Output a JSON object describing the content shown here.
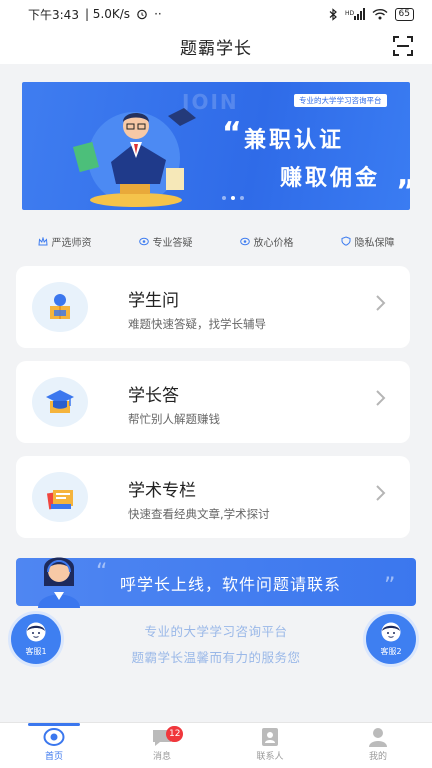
{
  "status_bar": {
    "time": "下午3:43",
    "network_speed": "| 5.0K/s",
    "extra_dots": "··",
    "signal_text": "HD",
    "battery": "65"
  },
  "header": {
    "title": "题霸学长"
  },
  "banner": {
    "watermark": "JOIN",
    "tagline": "专业的大学学习咨询平台",
    "headline_1": "兼职认证",
    "headline_2": "赚取佣金",
    "open_quote": "“",
    "close_quote": "”"
  },
  "features": [
    {
      "label": "严选师资",
      "icon": "crown-icon"
    },
    {
      "label": "专业答疑",
      "icon": "eye-icon"
    },
    {
      "label": "放心价格",
      "icon": "eye-icon"
    },
    {
      "label": "隐私保障",
      "icon": "shield-icon"
    }
  ],
  "cards": [
    {
      "title": "学生问",
      "desc": "难题快速答疑，找学长辅导",
      "icon": "student-book-icon"
    },
    {
      "title": "学长答",
      "desc": "帮忙别人解题赚钱",
      "icon": "graduation-cap-icon"
    },
    {
      "title": "学术专栏",
      "desc": "快速查看经典文章,学术探讨",
      "icon": "books-icon"
    }
  ],
  "contact": {
    "text": "呼学长上线，软件问题请联系",
    "quote_open": "“",
    "quote_close": "”"
  },
  "slogans": [
    "专业的大学学习咨询平台",
    "题霸学长温馨而有力的服务您"
  ],
  "kefu": [
    {
      "label": "客服1"
    },
    {
      "label": "客服2"
    }
  ],
  "tabs": [
    {
      "label": "首页",
      "active": true
    },
    {
      "label": "消息",
      "badge": "12"
    },
    {
      "label": "联系人"
    },
    {
      "label": "我的"
    }
  ],
  "colors": {
    "accent": "#3b77ee",
    "badge": "#f0373c",
    "background": "#f2f3f5"
  }
}
